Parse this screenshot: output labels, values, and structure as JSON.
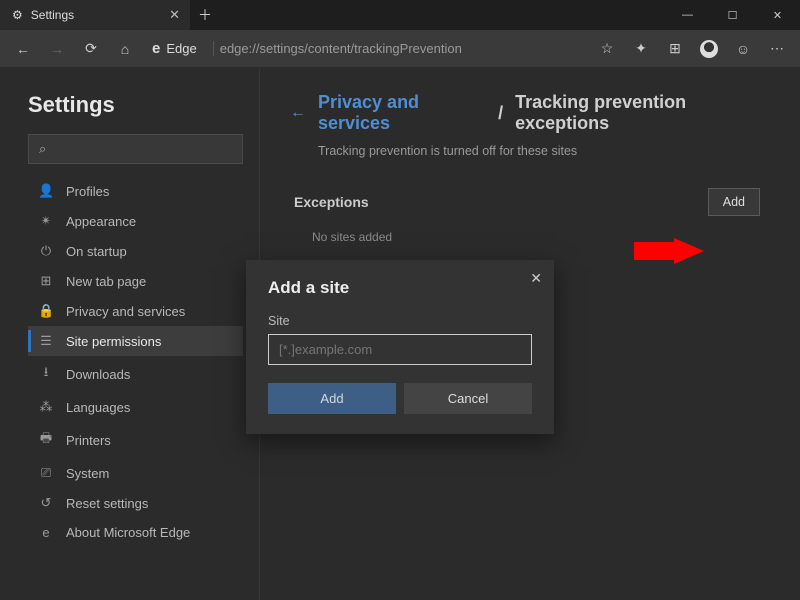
{
  "titlebar": {
    "tab_label": "Settings"
  },
  "addressbar": {
    "browser_label": "Edge",
    "url": "edge://settings/content/trackingPrevention"
  },
  "sidebar": {
    "title": "Settings",
    "search_placeholder": "",
    "items": [
      {
        "icon": "person-icon",
        "glyph": "👤",
        "label": "Profiles"
      },
      {
        "icon": "palette-icon",
        "glyph": "✴",
        "label": "Appearance"
      },
      {
        "icon": "power-icon",
        "glyph": "⏻",
        "label": "On startup"
      },
      {
        "icon": "tab-icon",
        "glyph": "⊞",
        "label": "New tab page"
      },
      {
        "icon": "lock-icon",
        "glyph": "🔒",
        "label": "Privacy and services"
      },
      {
        "icon": "shield-icon",
        "glyph": "☰",
        "label": "Site permissions"
      },
      {
        "icon": "download-icon",
        "glyph": "⭳",
        "label": "Downloads"
      },
      {
        "icon": "language-icon",
        "glyph": "⁂",
        "label": "Languages"
      },
      {
        "icon": "printer-icon",
        "glyph": "🖶",
        "label": "Printers"
      },
      {
        "icon": "system-icon",
        "glyph": "⎚",
        "label": "System"
      },
      {
        "icon": "reset-icon",
        "glyph": "↺",
        "label": "Reset settings"
      },
      {
        "icon": "edge-icon",
        "glyph": "e",
        "label": "About Microsoft Edge"
      }
    ],
    "active_index": 5
  },
  "main": {
    "breadcrumb_link": "Privacy and services",
    "breadcrumb_sep": "/",
    "breadcrumb_current": "Tracking prevention exceptions",
    "subtext": "Tracking prevention is turned off for these sites",
    "exceptions_heading": "Exceptions",
    "add_button": "Add",
    "no_sites": "No sites added"
  },
  "dialog": {
    "title": "Add a site",
    "field_label": "Site",
    "placeholder": "[*.]example.com",
    "value": "",
    "add": "Add",
    "cancel": "Cancel"
  },
  "annotation": {
    "arrow_color": "#ff0000"
  }
}
